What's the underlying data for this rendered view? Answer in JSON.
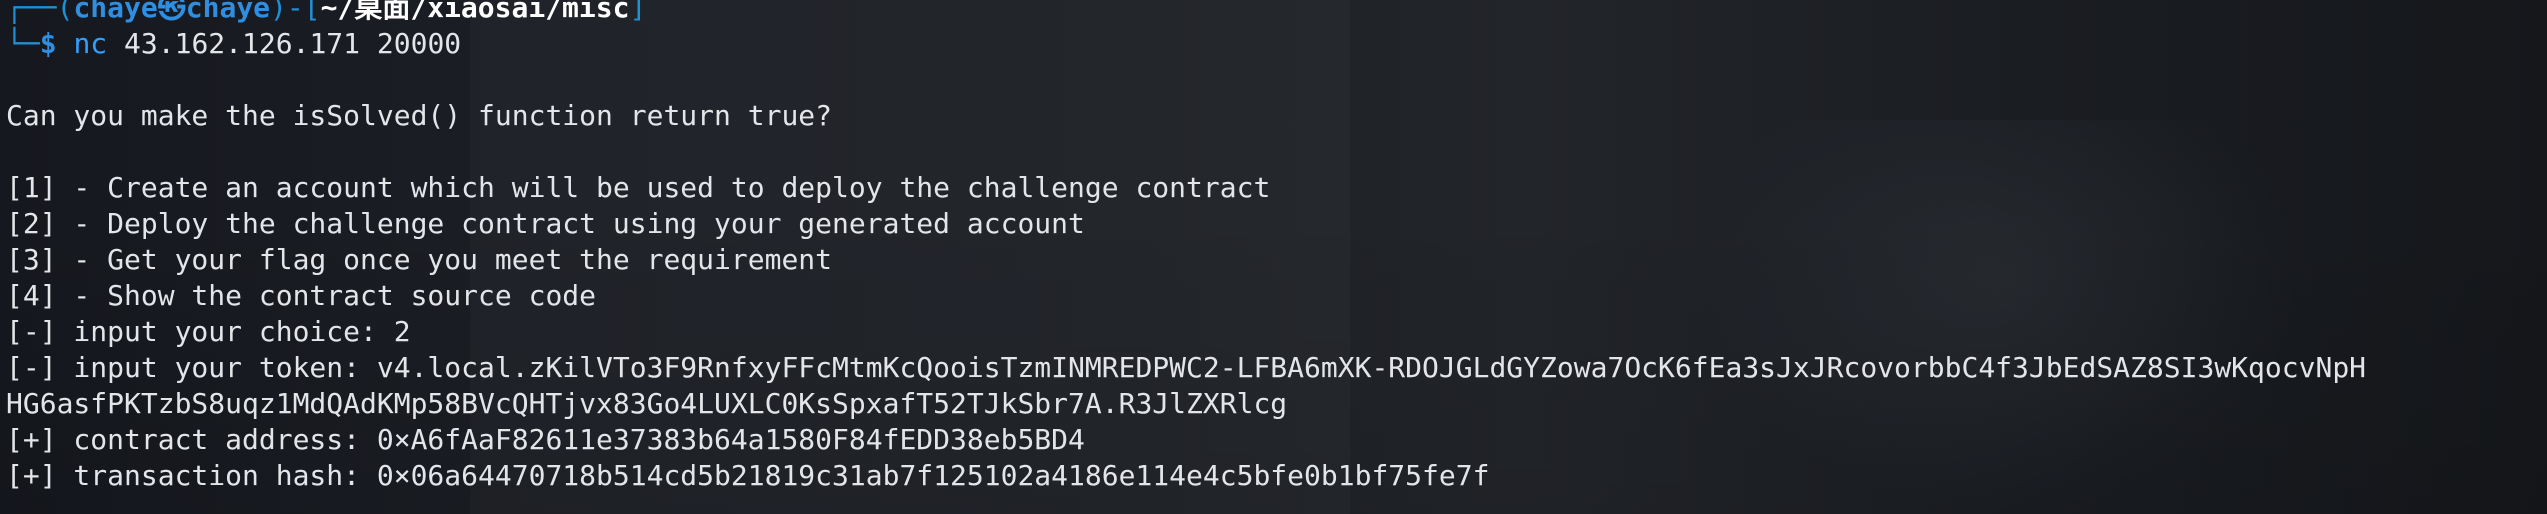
{
  "prompt": {
    "corner_top": "┌──(",
    "user": "chaye",
    "skull": "㉿",
    "host": "chaye",
    "mid": ")-[",
    "path": "~/桌面/xiaosai/misc",
    "end": "]",
    "corner_bottom": "└─",
    "dollar": "$",
    "command": "nc",
    "args": " 43.162.126.171 20000"
  },
  "output": {
    "question": "Can you make the isSolved() function return true?",
    "menu": [
      "[1] - Create an account which will be used to deploy the challenge contract",
      "[2] - Deploy the challenge contract using your generated account",
      "[3] - Get your flag once you meet the requirement",
      "[4] - Show the contract source code"
    ],
    "choice_line": "[-] input your choice: 2",
    "token_line_1": "[-] input your token: v4.local.zKilVTo3F9RnfxyFFcMtmKcQooisTzmINMREDPWC2-LFBA6mXK-RDOJGLdGYZowa7OcK6fEa3sJxJRcovorbbC4f3JbEdSAZ8SI3wKqocvNpH",
    "token_line_2": "HG6asfPKTzbS8uqz1MdQAdKMp58BVcQHTjvx83Go4LUXLC0KsSpxafT52TJkSbr7A.R3JlZXRlcg",
    "contract_line": "[+] contract address: 0×A6fAaF82611e37383b64a1580F84fEDD38eb5BD4",
    "tx_line": "[+] transaction hash: 0×06a64470718b514cd5b21819c31ab7f125102a4186e114e4c5bfe0b1bf75fe7f"
  },
  "colors": {
    "prompt_accent": "#2f8ee0",
    "path": "#ffffff",
    "text": "#e3e5e8",
    "background": "#1b1e24"
  }
}
